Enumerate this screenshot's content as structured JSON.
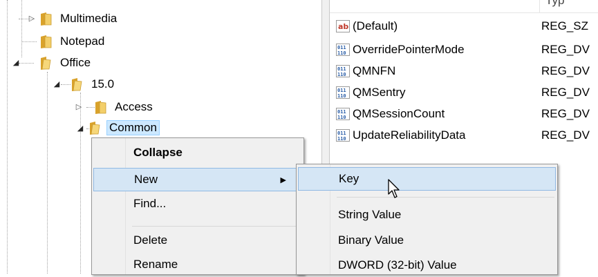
{
  "tree": {
    "items": [
      {
        "label": "Multimedia",
        "expander": "collapsed"
      },
      {
        "label": "Notepad",
        "expander": "none"
      },
      {
        "label": "Office",
        "expander": "expanded"
      },
      {
        "label": "15.0",
        "expander": "expanded"
      },
      {
        "label": "Access",
        "expander": "collapsed"
      },
      {
        "label": "Common",
        "expander": "expanded",
        "selected": true
      }
    ]
  },
  "values_pane": {
    "type_header_partial": "Typ",
    "rows": [
      {
        "icon": "string-value-icon",
        "name": "(Default)",
        "type": "REG_SZ"
      },
      {
        "icon": "binary-value-icon",
        "name": "OverridePointerMode",
        "type": "REG_DV"
      },
      {
        "icon": "binary-value-icon",
        "name": "QMNFN",
        "type": "REG_DV"
      },
      {
        "icon": "binary-value-icon",
        "name": "QMSentry",
        "type": "REG_DV"
      },
      {
        "icon": "binary-value-icon",
        "name": "QMSessionCount",
        "type": "REG_DV"
      },
      {
        "icon": "binary-value-icon",
        "name": "UpdateReliabilityData",
        "type": "REG_DV"
      }
    ]
  },
  "context_menu": {
    "collapse": "Collapse",
    "new": "New",
    "find": "Find...",
    "delete": "Delete",
    "rename": "Rename"
  },
  "submenu": {
    "key": "Key",
    "string_value": "String Value",
    "binary_value": "Binary Value",
    "dword_value": "DWORD (32-bit) Value"
  },
  "colors": {
    "highlight": "#d5e6f5",
    "highlight_border": "#8fb8e3",
    "selection": "#cce8ff",
    "folder": "#e8b84a"
  }
}
